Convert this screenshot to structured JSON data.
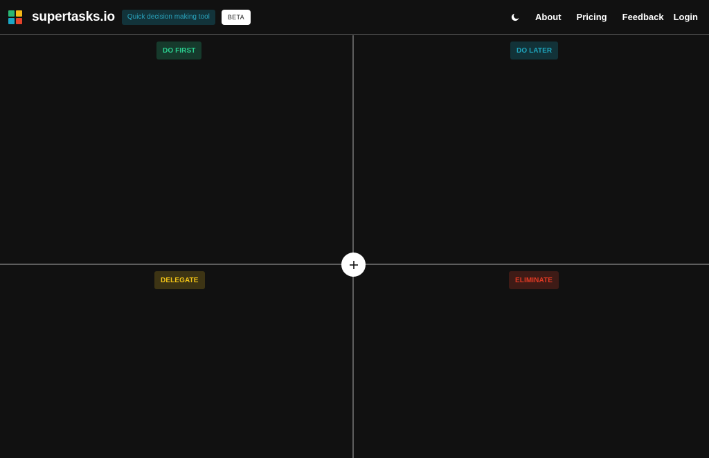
{
  "header": {
    "brand_name": "supertasks.io",
    "tagline": "Quick decision making tool",
    "beta": "BETA",
    "nav": {
      "about": "About",
      "pricing": "Pricing",
      "feedback": "Feedback",
      "login": "Login"
    },
    "icons": {
      "logo": "four-square-logo-icon",
      "theme_toggle": "moon-icon"
    }
  },
  "quadrants": {
    "top_left": {
      "label": "DO FIRST",
      "color": "#2bcf8f",
      "bg": "#163a2c"
    },
    "top_right": {
      "label": "DO LATER",
      "color": "#1fa7bf",
      "bg": "#123238"
    },
    "bottom_left": {
      "label": "DELEGATE",
      "color": "#f2c417",
      "bg": "#3d3414"
    },
    "bottom_right": {
      "label": "ELIMINATE",
      "color": "#e33a24",
      "bg": "#3e1b16"
    }
  },
  "add_button": {
    "icon": "plus-icon"
  },
  "colors": {
    "background": "#111111",
    "divider": "#5e5e5e",
    "logo_green": "#2bb673",
    "logo_blue": "#1ba6c5",
    "logo_yellow": "#f5b917",
    "logo_red": "#e5432b",
    "tagline_text": "#2aa5bf",
    "tagline_bg": "#12333a"
  }
}
